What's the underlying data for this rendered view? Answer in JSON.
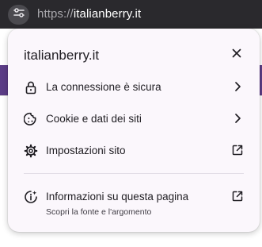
{
  "address_bar": {
    "scheme": "https://",
    "host": "italianberry.it"
  },
  "popup": {
    "title": "italianberry.it",
    "close_icon": "close-icon",
    "items": [
      {
        "label": "La connessione è sicura",
        "icon": "lock-icon",
        "trail": "chevron-right-icon"
      },
      {
        "label": "Cookie e dati dei siti",
        "icon": "cookie-icon",
        "trail": "chevron-right-icon"
      },
      {
        "label": "Impostazioni sito",
        "icon": "gear-icon",
        "trail": "external-link-icon"
      }
    ],
    "info": {
      "label": "Informazioni su questa pagina",
      "sublabel": "Scopri la fonte e l'argomento",
      "icon": "info-spark-icon",
      "trail": "external-link-icon"
    }
  },
  "colors": {
    "popup_bg": "#fbf7fc",
    "chrome_bg": "#2a292d",
    "page_accent": "#5b3d86",
    "text": "#1f1d22"
  }
}
